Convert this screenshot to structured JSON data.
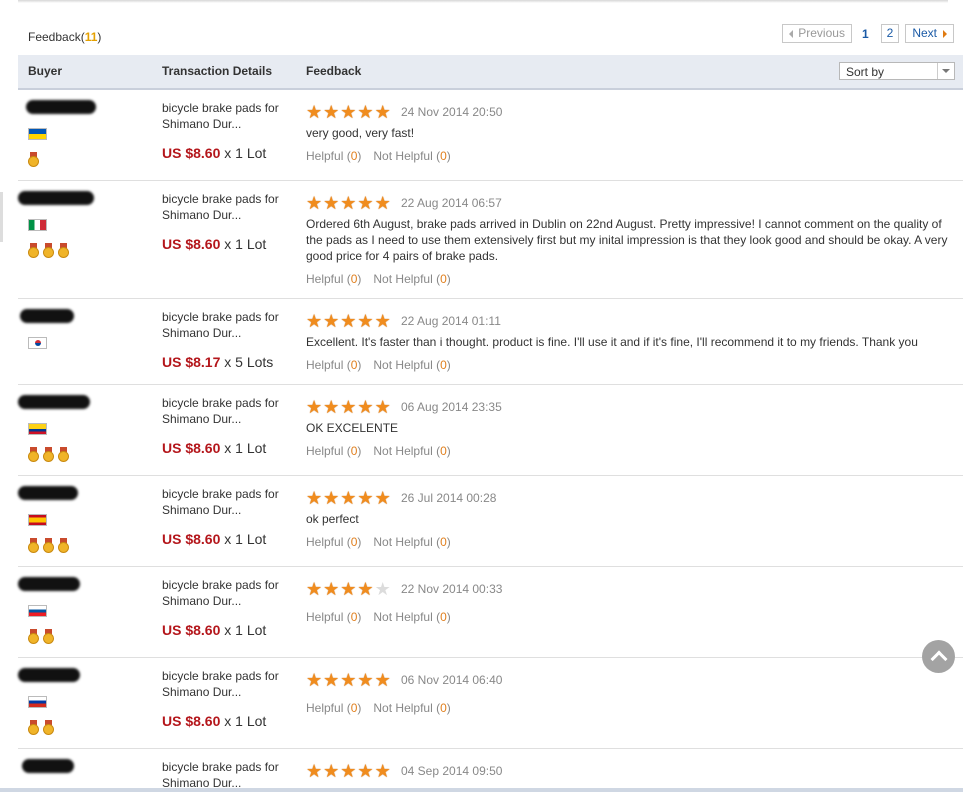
{
  "header": {
    "feedback_label": "Feedback(",
    "feedback_count": "11",
    "feedback_close": ")"
  },
  "pagination": {
    "previous": "Previous",
    "current": "1",
    "page2": "2",
    "next": "Next"
  },
  "table": {
    "col_buyer": "Buyer",
    "col_transaction": "Transaction Details",
    "col_feedback": "Feedback",
    "sort_by": "Sort by"
  },
  "helpful_label": "Helpful",
  "not_helpful_label": "Not Helpful",
  "reviews": [
    {
      "flag": [
        "#ffd500",
        "#0057b7",
        "h"
      ],
      "medals": 1,
      "product": "bicycle brake pads for Shimano Dur...",
      "currency": "US $8.60",
      "qty": "x 1 Lot",
      "rating": 5,
      "date": "24 Nov 2014 20:50",
      "comment": "very good, very fast!",
      "helpful": "0",
      "not_helpful": "0"
    },
    {
      "flag": [
        "#009246",
        "#ffffff",
        "#ce2b37"
      ],
      "medals": 3,
      "product": "bicycle brake pads for Shimano Dur...",
      "currency": "US $8.60",
      "qty": "x 1 Lot",
      "rating": 5,
      "date": "22 Aug 2014 06:57",
      "comment": "Ordered 6th August, brake pads arrived in Dublin on 22nd August. Pretty impressive! I cannot comment on the quality of the pads as I need to use them extensively first but my inital impression is that they look good and should be okay. A very good price for 4 pairs of brake pads.",
      "helpful": "0",
      "not_helpful": "0"
    },
    {
      "flag": [
        "#ffffff",
        "#cd2e3a",
        "k"
      ],
      "medals": 0,
      "product": "bicycle brake pads for Shimano Dur...",
      "currency": "US $8.17",
      "qty": "x 5 Lots",
      "rating": 5,
      "date": "22 Aug 2014 01:11",
      "comment": "Excellent. It's faster than i thought. product is fine. I'll use it and if it's fine, I'll recommend it to my friends. Thank you",
      "helpful": "0",
      "not_helpful": "0"
    },
    {
      "flag": [
        "#fcd116",
        "#003893",
        "#ce1126"
      ],
      "medals": 3,
      "product": "bicycle brake pads for Shimano Dur...",
      "currency": "US $8.60",
      "qty": "x 1 Lot",
      "rating": 5,
      "date": "06 Aug 2014 23:35",
      "comment": "OK EXCELENTE",
      "helpful": "0",
      "not_helpful": "0"
    },
    {
      "flag": [
        "#c60b1e",
        "#ffc400",
        "e"
      ],
      "medals": 3,
      "product": "bicycle brake pads for Shimano Dur...",
      "currency": "US $8.60",
      "qty": "x 1 Lot",
      "rating": 5,
      "date": "26 Jul 2014 00:28",
      "comment": "ok perfect",
      "helpful": "0",
      "not_helpful": "0"
    },
    {
      "flag": [
        "#ffffff",
        "#0055a4",
        "#ed1c24"
      ],
      "medals": 2,
      "product": "bicycle brake pads for Shimano Dur...",
      "currency": "US $8.60",
      "qty": "x 1 Lot",
      "rating": 4,
      "date": "22 Nov 2014 00:33",
      "comment": "",
      "helpful": "0",
      "not_helpful": "0"
    },
    {
      "flag": [
        "#ffffff",
        "#0039a6",
        "#d52b1e"
      ],
      "medals": 2,
      "product": "bicycle brake pads for Shimano Dur...",
      "currency": "US $8.60",
      "qty": "x 1 Lot",
      "rating": 5,
      "date": "06 Nov 2014 06:40",
      "comment": "",
      "helpful": "0",
      "not_helpful": "0"
    },
    {
      "flag": null,
      "medals": 0,
      "product": "bicycle brake pads for Shimano Dur...",
      "currency": "",
      "qty": "",
      "rating": 5,
      "date": "04 Sep 2014 09:50",
      "comment": "",
      "helpful": "",
      "not_helpful": ""
    }
  ]
}
